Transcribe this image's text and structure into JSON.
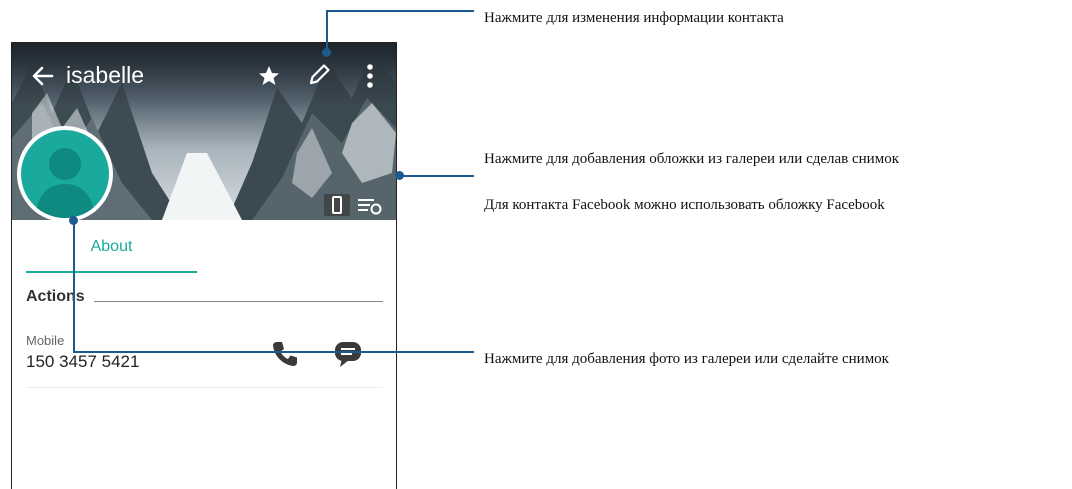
{
  "contact": {
    "name": "isabelle",
    "tab_label": "About",
    "section_title": "Actions",
    "phone_type": "Mobile",
    "phone_number": "150 3457 5421"
  },
  "callouts": {
    "edit_info": "Нажмите для изменения информации контакта",
    "cover_gallery": "Нажмите для добавления обложки из галереи или сделав снимок",
    "cover_facebook": "Для контакта Facebook можно использовать обложку Facebook",
    "photo_gallery": "Нажмите для добавления фото из галереи или сделайте снимок"
  },
  "colors": {
    "accent": "#1aa99d",
    "callout_line": "#1f5a8f"
  },
  "icons": [
    "back-arrow-icon",
    "star-icon",
    "pencil-icon",
    "more-vertical-icon",
    "phone-icon",
    "message-icon",
    "person-icon"
  ]
}
